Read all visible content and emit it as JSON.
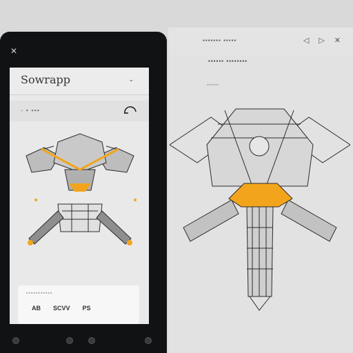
{
  "app": {
    "title": "Sowrapp",
    "header_chevron": "⌄",
    "sub_label": "◦ ▪ ▪▪▪",
    "card_title": "▪▪▪▪▪▪▪▪▪▪▪",
    "card_items": [
      "AB",
      "SCVV",
      "PS"
    ],
    "page_dots": "▪▪ ▪▪▪ ▪▪▪▪▪"
  },
  "panel": {
    "title": "▪▪▪▪▪▪▪ ▪▪▪▪▪",
    "subtitle": "▪▪▪▪▪▪ ▪▪▪▪▪▪▪▪",
    "hint": "▪▪▪▪▪▪▪"
  },
  "icons": {
    "close": "✕",
    "panel": [
      "◁",
      "▷",
      "✕"
    ]
  },
  "colors": {
    "accent": "#f2a51c",
    "line": "#2b2b2b",
    "screen_bg": "#e9e9e9",
    "device": "#111214"
  }
}
